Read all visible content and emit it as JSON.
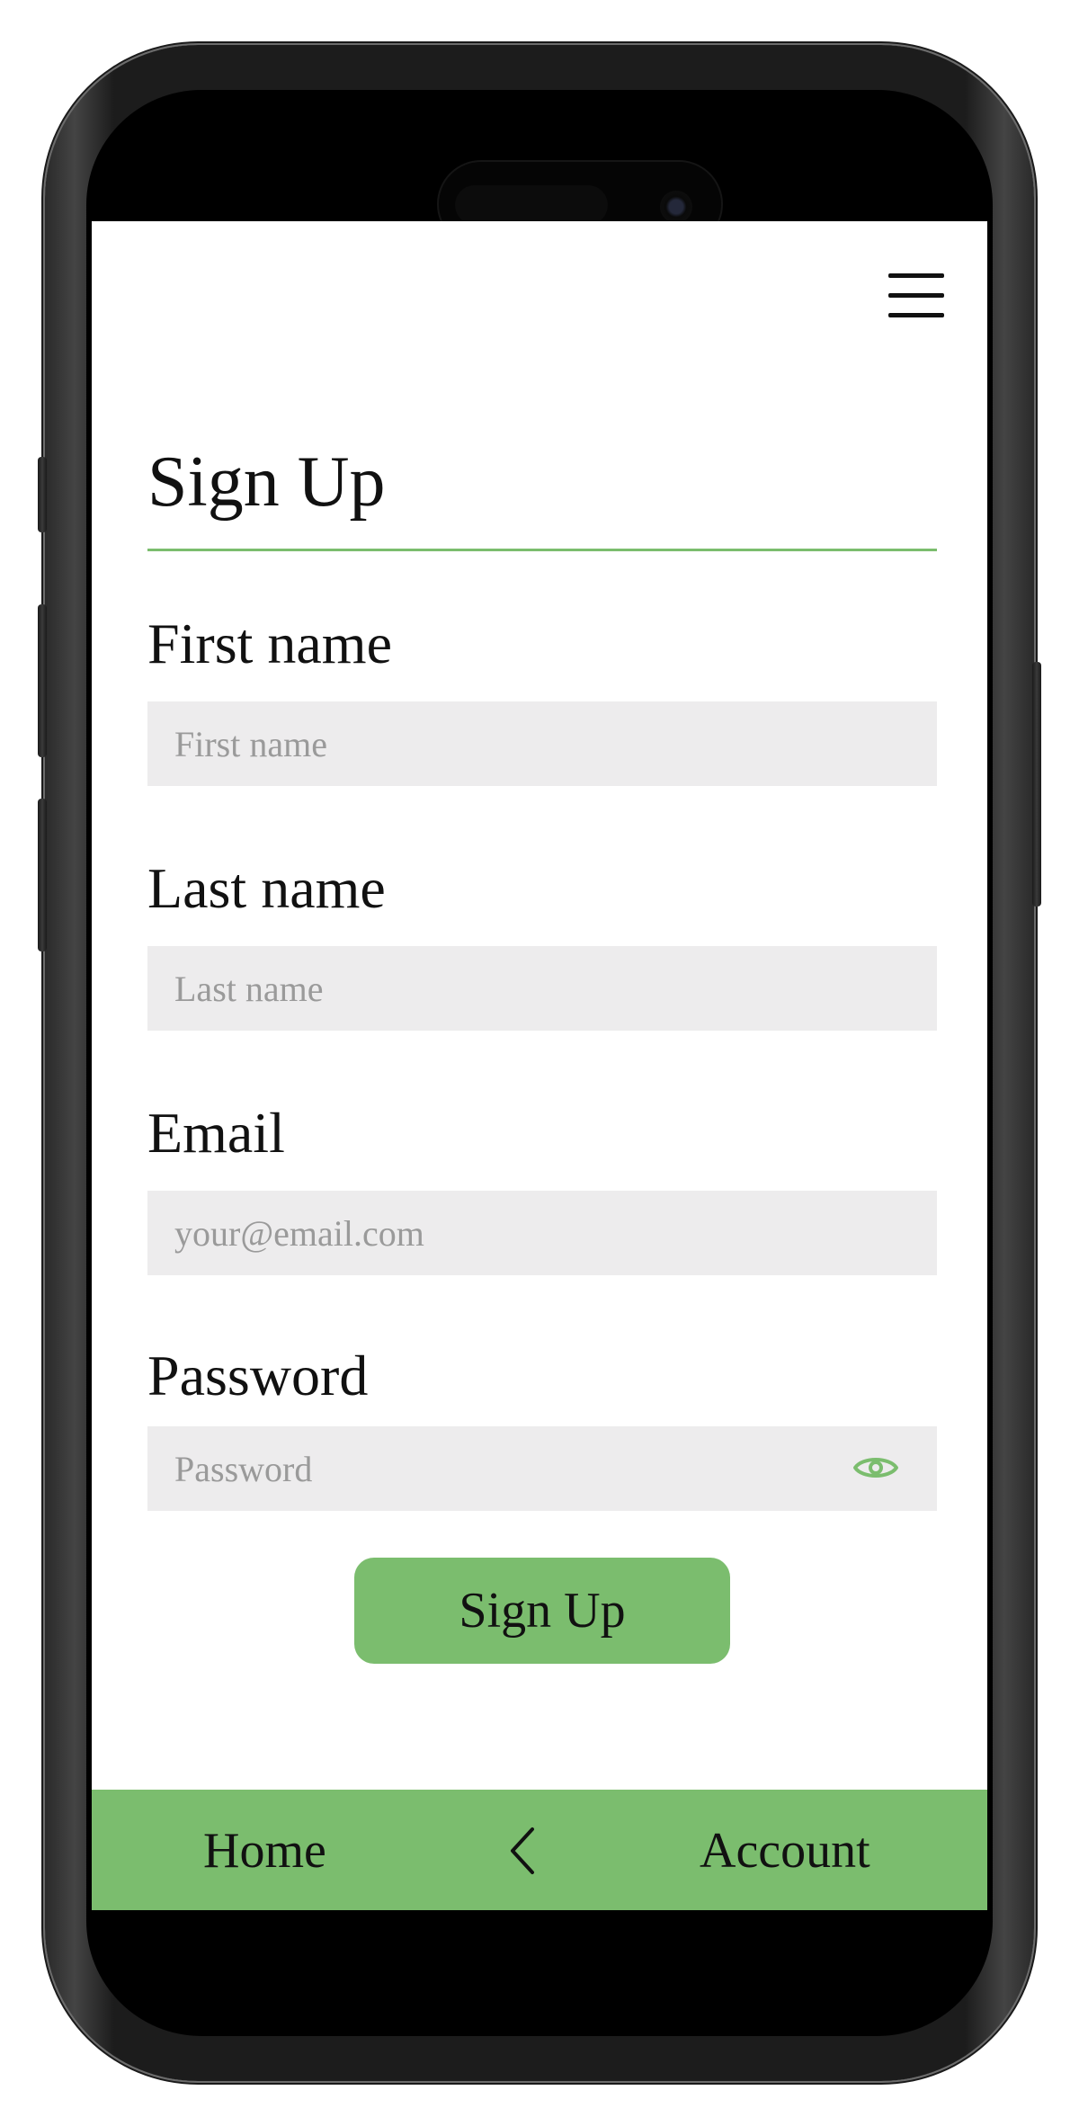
{
  "header": {
    "menu_icon": "hamburger-menu-icon"
  },
  "form": {
    "title": "Sign Up",
    "fields": [
      {
        "label": "First name",
        "placeholder": "First name"
      },
      {
        "label": "Last name",
        "placeholder": "Last name"
      },
      {
        "label": "Email",
        "placeholder": "your@email.com"
      },
      {
        "label": "Password",
        "placeholder": "Password"
      }
    ],
    "password_toggle_icon": "eye-icon",
    "submit_label": "Sign Up"
  },
  "bottom_nav": {
    "home_label": "Home",
    "back_icon": "chevron-left-icon",
    "account_label": "Account"
  },
  "colors": {
    "accent": "#7bbd6e",
    "input_background": "#edeced",
    "text": "#111111",
    "placeholder": "#9a9a9a"
  }
}
